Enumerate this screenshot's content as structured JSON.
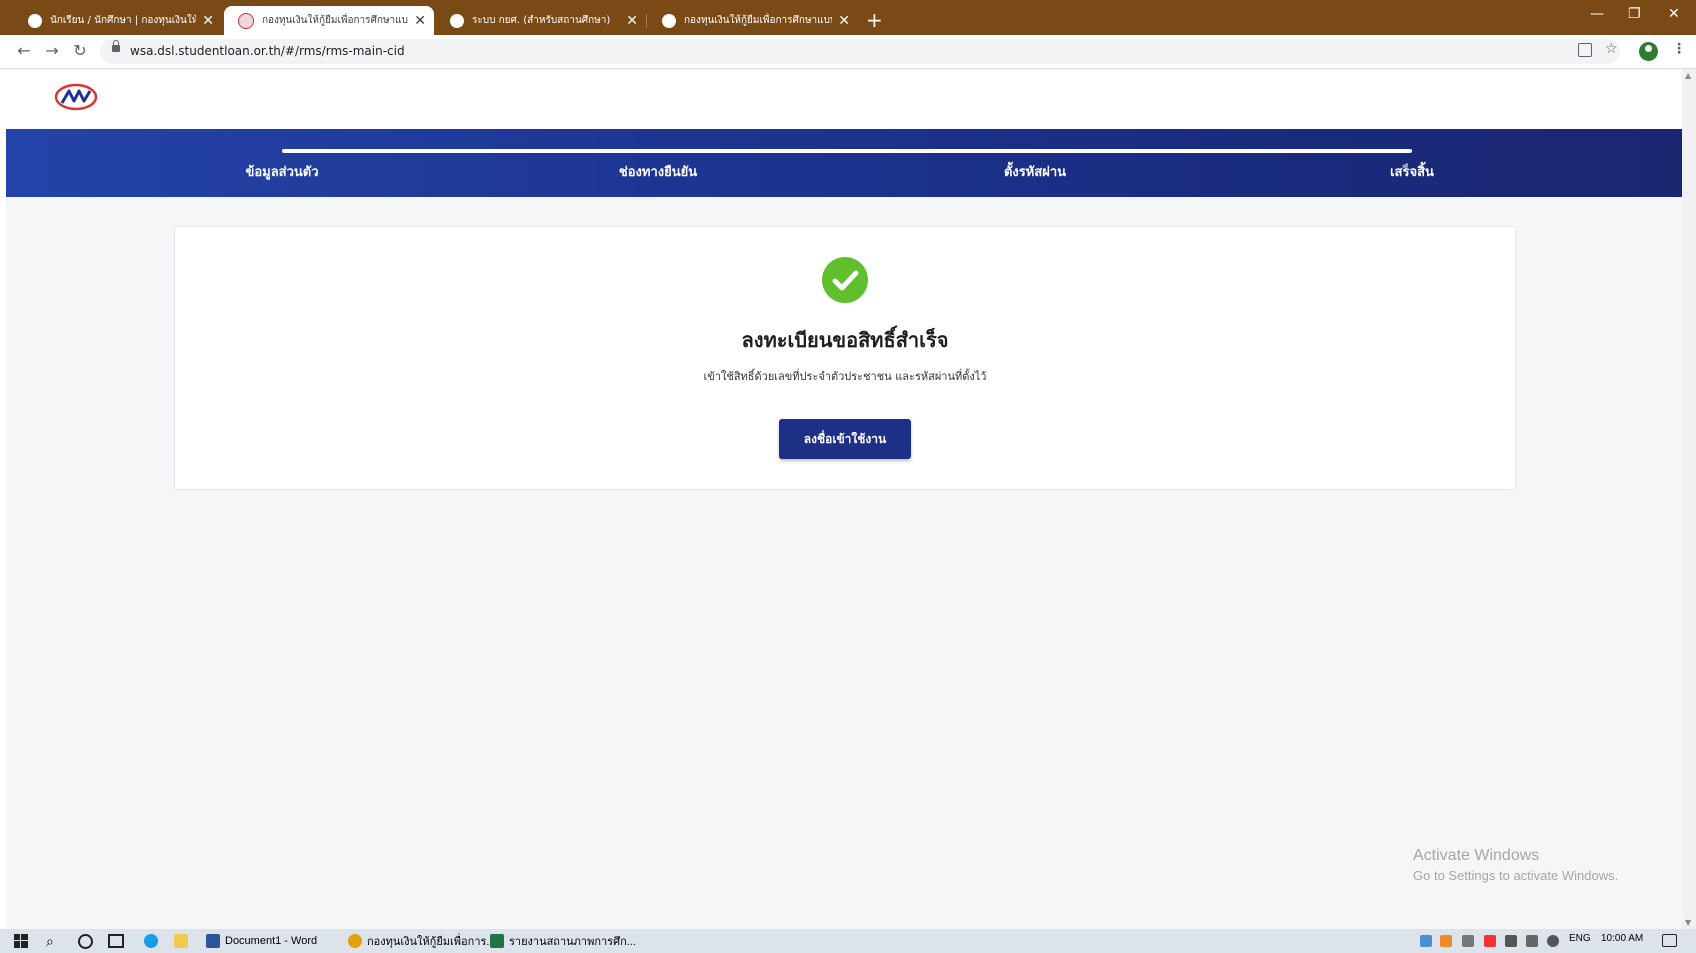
{
  "browser": {
    "tabs": [
      {
        "title": "นักเรียน / นักศึกษา | กองทุนเงินให้กู้ยืม...",
        "active": false
      },
      {
        "title": "กองทุนเงินให้กู้ยืมเพื่อการศึกษาแบบดิจิ...",
        "active": true
      },
      {
        "title": "ระบบ กยศ. (สำหรับสถานศึกษา)",
        "active": false
      },
      {
        "title": "กองทุนเงินให้กู้ยืมเพื่อการศึกษาแบบดิจิ...",
        "active": false
      }
    ],
    "new_tab": "+",
    "tab_close": "✕",
    "url": "wsa.dsl.studentloan.or.th/#/rms/rms-main-cid",
    "nav": {
      "back": "←",
      "forward": "→",
      "reload": "↻"
    },
    "window_controls": {
      "minimize": "—",
      "restore": "❐",
      "close": "✕"
    }
  },
  "stepper": {
    "steps": [
      "ข้อมูลส่วนตัว",
      "ช่องทางยืนยัน",
      "ตั้งรหัสผ่าน",
      "เสร็จสิ้น"
    ],
    "completed_fraction": 1.0
  },
  "result": {
    "title": "ลงทะเบียนขอสิทธิ์สำเร็จ",
    "message": "เข้าใช้สิทธิ์ด้วยเลขที่ประจำตัวประชาชน และรหัสผ่านที่ตั้งไว้",
    "login_button": "ลงชื่อเข้าใช้งาน"
  },
  "watermark": {
    "line1": "Activate Windows",
    "line2": "Go to Settings to activate Windows."
  },
  "taskbar": {
    "apps": [
      {
        "label": "Document1 - Word",
        "color": "#2b579a"
      },
      {
        "label": "กองทุนเงินให้กู้ยืมเพื่อการ...",
        "color": "#e0a010"
      },
      {
        "label": "รายงานสถานภาพการศึก...",
        "color": "#217346"
      }
    ],
    "language": "ENG",
    "time": "10:00 AM"
  },
  "colors": {
    "stepbar": "#1e3290",
    "success": "#5fbf2c",
    "button": "#1e2f86",
    "tabstrip": "#7a4a16"
  }
}
